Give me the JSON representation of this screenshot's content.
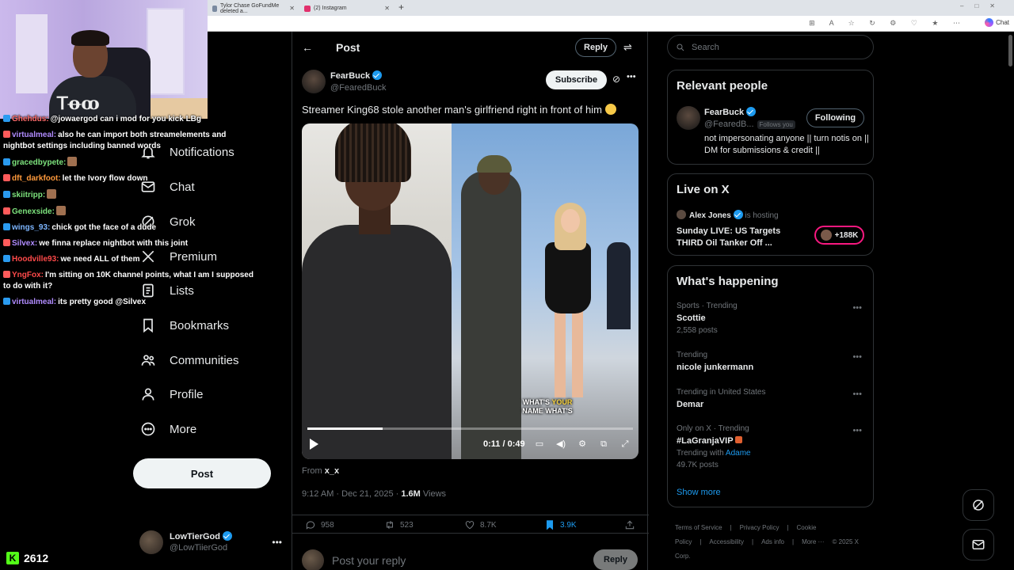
{
  "browser": {
    "tabs": [
      {
        "label": "Tylor Chase GoFundMe deleted a..."
      },
      {
        "label": "(2) Instagram"
      }
    ],
    "new_tab": "+",
    "copilot_label": "Chat"
  },
  "chat": {
    "messages": [
      {
        "user": "Ghehdus:",
        "text": "@jowaergod can i mod for you kick LBg",
        "color": "#ff6b6b"
      },
      {
        "user": "virtualmeal:",
        "text": "also he can import both streamelements and nightbot settings including banned words",
        "color": "#b18cff"
      },
      {
        "user": "gracedbypete:",
        "text": "",
        "color": "#7de37d"
      },
      {
        "user": "dft_darkfoot:",
        "text": "let the Ivory  flow down",
        "color": "#ff9a3c"
      },
      {
        "user": "skiitripp:",
        "text": "",
        "color": "#7de37d"
      },
      {
        "user": "Genexside:",
        "text": "",
        "color": "#7de37d"
      },
      {
        "user": "wings_93:",
        "text": "chick got the face of a dude",
        "color": "#7db6ff"
      },
      {
        "user": "Silvex:",
        "text": "we finna replace nightbot with this joint",
        "color": "#b18cff"
      },
      {
        "user": "Hoodville93:",
        "text": "we need ALL of them",
        "color": "#ff4a4a"
      },
      {
        "user": "YngFox:",
        "text": "I'm sitting on 10K channel points, what I am I supposed to do with it?",
        "color": "#ff4a4a"
      },
      {
        "user": "virtualmeal:",
        "text": "its pretty good @Silvex",
        "color": "#b18cff"
      }
    ],
    "kick_count": "2612"
  },
  "nav": {
    "items": [
      {
        "label": "Notifications",
        "icon": "bell-icon"
      },
      {
        "label": "Chat",
        "icon": "mail-icon"
      },
      {
        "label": "Grok",
        "icon": "grok-icon"
      },
      {
        "label": "Premium",
        "icon": "x-logo-icon"
      },
      {
        "label": "Lists",
        "icon": "list-icon"
      },
      {
        "label": "Bookmarks",
        "icon": "bookmark-icon"
      },
      {
        "label": "Communities",
        "icon": "communities-icon"
      },
      {
        "label": "Profile",
        "icon": "profile-icon"
      },
      {
        "label": "More",
        "icon": "more-circle-icon"
      }
    ],
    "post_button": "Post",
    "account": {
      "display_name": "LowTierGod",
      "handle": "@LowTiierGod"
    }
  },
  "post": {
    "header_title": "Post",
    "reply_button": "Reply",
    "author": {
      "display_name": "FearBuck",
      "handle": "@FearedBuck"
    },
    "subscribe_label": "Subscribe",
    "text": "Streamer King68 stole another man's girlfriend right in front of him",
    "video": {
      "caption_highlight": "YOUR",
      "caption_pre": "WHAT'S",
      "caption_post": "NAME WHAT'S",
      "time": "0:11 / 0:49",
      "progress": 0.23
    },
    "from_label": "From",
    "from_source": "x_x",
    "timestamp": "9:12 AM · Dec 21, 2025 · ",
    "views_count": "1.6M",
    "views_label": " Views",
    "stats": {
      "replies": "958",
      "reposts": "523",
      "likes": "8.7K",
      "bookmarks": "3.9K"
    },
    "reply_placeholder": "Post your reply",
    "reply_submit": "Reply"
  },
  "sidebar": {
    "search_placeholder": "Search",
    "relevant": {
      "title": "Relevant people",
      "display_name": "FearBuck",
      "handle": "@FearedB...",
      "follows_you": "Follows you",
      "following_button": "Following",
      "bio": "not impersonating anyone || turn notis on || DM for submissions & credit ||"
    },
    "live": {
      "title": "Live on X",
      "host": "Alex Jones",
      "hosting": "is hosting",
      "stream_title": "Sunday LIVE: US Targets THIRD Oil Tanker Off ...",
      "listeners": "+188K"
    },
    "happening": {
      "title": "What's happening",
      "trends": [
        {
          "context": "Sports · Trending",
          "name": "Scottie",
          "count": "2,558 posts"
        },
        {
          "context": "Trending",
          "name": "nicole junkermann",
          "count": ""
        },
        {
          "context": "Trending in United States",
          "name": "Demar",
          "count": ""
        },
        {
          "context": "Only on X · Trending",
          "name": "#LaGranjaVIP",
          "with_label": "Trending with",
          "with": "Adame",
          "count": "49.7K posts"
        }
      ],
      "show_more": "Show more"
    },
    "footer": [
      "Terms of Service",
      "|",
      "Privacy Policy",
      "|",
      "Cookie Policy",
      "|",
      "Accessibility",
      "|",
      "Ads info",
      "|",
      "More ···",
      "© 2025 X Corp."
    ]
  }
}
